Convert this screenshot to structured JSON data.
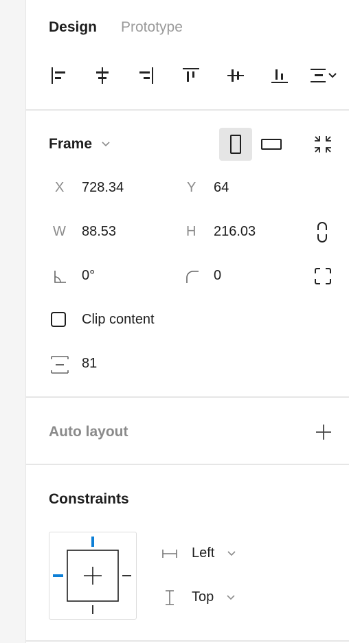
{
  "tabs": [
    {
      "label": "Design",
      "active": true
    },
    {
      "label": "Prototype",
      "active": false
    }
  ],
  "align_icons": [
    "align-left-icon",
    "align-horizontal-center-icon",
    "align-right-icon",
    "align-top-icon",
    "align-vertical-center-icon",
    "align-bottom-icon",
    "distribute-dropdown-icon"
  ],
  "frame": {
    "title": "Frame",
    "orientation_selected": "portrait",
    "x_label": "X",
    "x_value": "728.34",
    "y_label": "Y",
    "y_value": "64",
    "w_label": "W",
    "w_value": "88.53",
    "h_label": "H",
    "h_value": "216.03",
    "rotation_value": "0°",
    "radius_value": "0",
    "clip_content_label": "Clip content",
    "clip_content_checked": false,
    "spacing_value": "81"
  },
  "auto_layout": {
    "title": "Auto layout"
  },
  "constraints": {
    "title": "Constraints",
    "horizontal_value": "Left",
    "vertical_value": "Top",
    "accent_color": "#0d7fd6"
  }
}
